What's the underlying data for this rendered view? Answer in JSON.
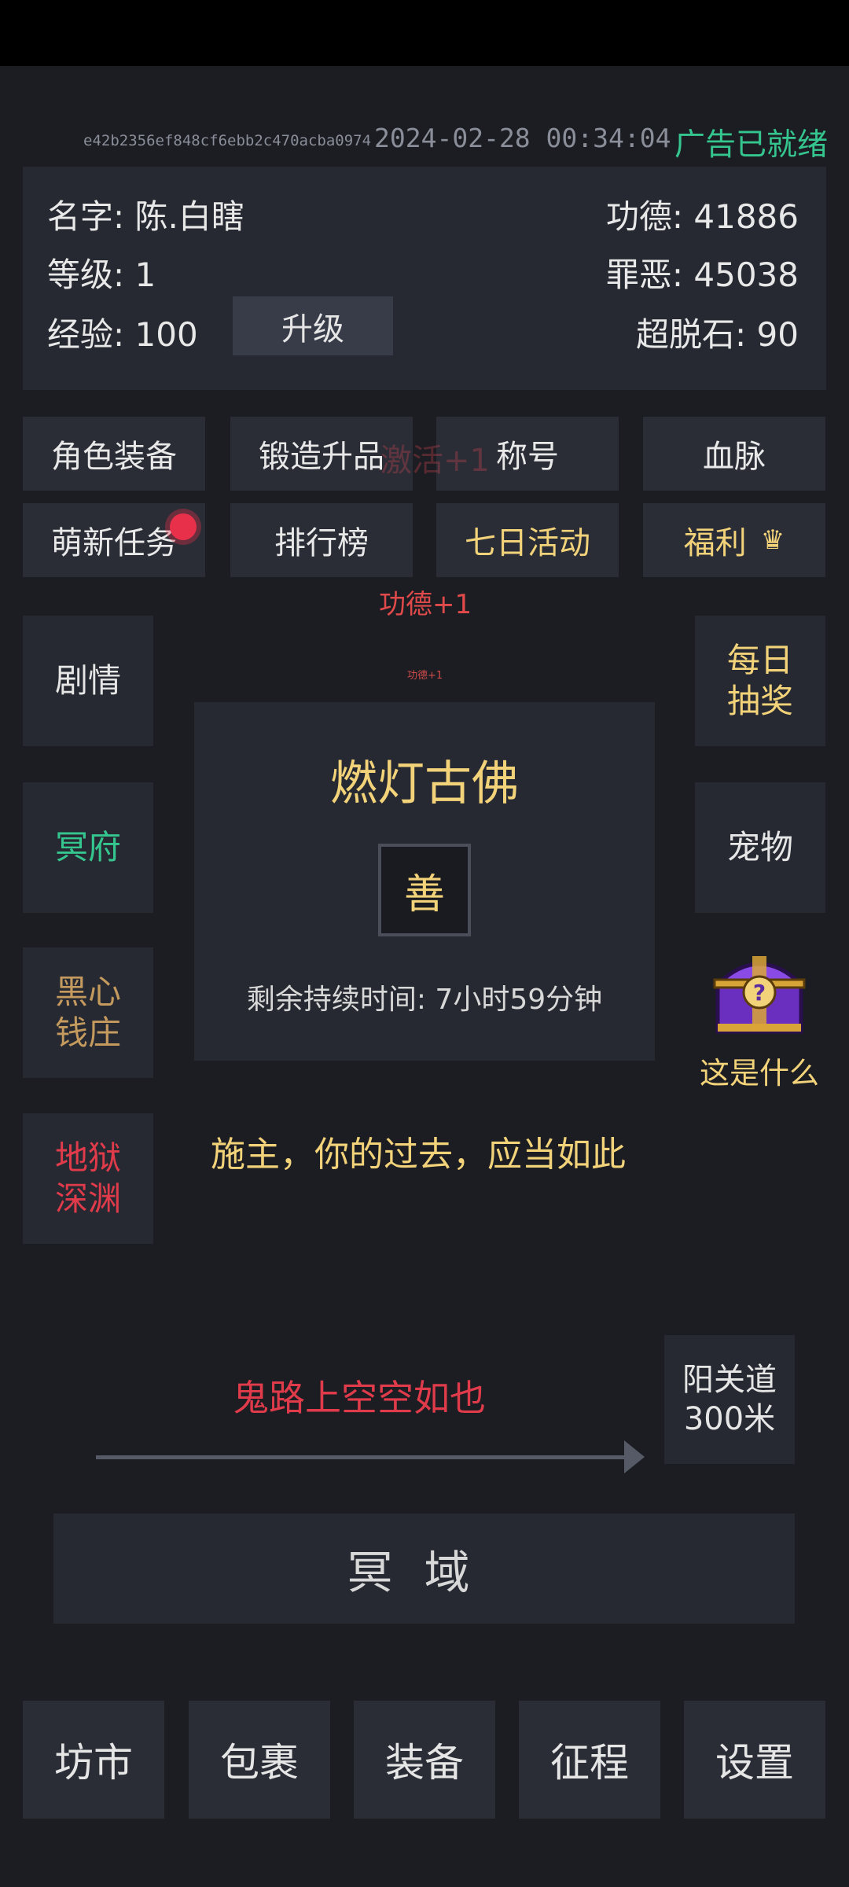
{
  "header": {
    "id": "e42b2356ef848cf6ebb2c470acba0974",
    "datetime": "2024-02-28 00:34:04",
    "ad_status": "广告已就绪"
  },
  "stats": {
    "name": "名字: 陈.白瞎",
    "level": "等级: 1",
    "exp": "经验: 100",
    "upgrade_label": "升级",
    "merit": "功德: 41886",
    "sin": "罪恶: 45038",
    "stone": "超脱石: 90"
  },
  "menu": {
    "row1": [
      "角色装备",
      "锻造升品",
      "称号",
      "血脉"
    ],
    "row2": [
      "萌新任务",
      "排行榜",
      "七日活动",
      "福利"
    ]
  },
  "ghost_text": "激活+1",
  "float_merit": "功德+1",
  "float_merit_small": "功德+1",
  "left_side": {
    "story": "剧情",
    "underworld": "冥府",
    "bank_line1": "黑心",
    "bank_line2": "钱庄",
    "abyss_line1": "地狱",
    "abyss_line2": "深渊"
  },
  "right_side": {
    "lottery_line1": "每日",
    "lottery_line2": "抽奖",
    "pet": "宠物",
    "what": "这是什么"
  },
  "buddha": {
    "name": "燃灯古佛",
    "badge": "善",
    "remaining": "剩余持续时间: 7小时59分钟"
  },
  "quote": "施主，你的过去，应当如此",
  "road": {
    "status": "鬼路上空空如也",
    "dest_line1": "阳关道",
    "dest_line2": "300米"
  },
  "realm_button": "冥域",
  "bottom_nav": [
    "坊市",
    "包裹",
    "装备",
    "征程",
    "设置"
  ],
  "colors": {
    "background": "#1b1d22",
    "panel": "#262931",
    "gold": "#f3d37a",
    "green": "#35c58f",
    "red": "#e03b4b",
    "bronze": "#c49a5e",
    "purple_chest": "#7b3fd6"
  },
  "icons": {
    "notification": "red-dot-icon",
    "welfare": "crown-icon",
    "chest": "treasure-chest-icon",
    "arrow": "arrow-right-icon"
  }
}
